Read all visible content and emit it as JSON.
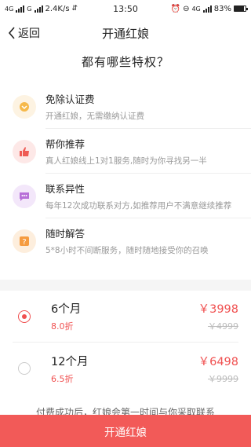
{
  "status_bar": {
    "network_1": "4G",
    "network_2": "G",
    "speed": "2.4K/s",
    "time": "13:50",
    "network_3": "4G",
    "battery": "83%",
    "battery_level": 0.83
  },
  "nav": {
    "back_label": "返回",
    "title": "开通红娘"
  },
  "heading": "都有哪些特权？",
  "features": [
    {
      "title": "免除认证费",
      "desc": "开通红娘，无需缴纳认证费",
      "icon": "badge-icon",
      "color": "#f6b94a",
      "bg": "#fdf3e2"
    },
    {
      "title": "帮你推荐",
      "desc": "真人红娘线上1对1服务,随时为你寻找另一半",
      "icon": "thumbs-up-icon",
      "color": "#ef5b54",
      "bg": "#fde8e7"
    },
    {
      "title": "联系异性",
      "desc": "每年12次成功联系对方,如推荐用户不满意继续推荐",
      "icon": "chat-icon",
      "color": "#b76fd8",
      "bg": "#f3e7fa"
    },
    {
      "title": "随时解答",
      "desc": "5*8小时不间断服务，随时随地接受你的召唤",
      "icon": "question-icon",
      "color": "#f59b3f",
      "bg": "#fdeedd"
    }
  ],
  "plans": [
    {
      "name": "6个月",
      "discount": "8.0折",
      "price": "￥3998",
      "original": "￥4999",
      "selected": true
    },
    {
      "name": "12个月",
      "discount": "6.5折",
      "price": "￥6498",
      "original": "￥9999",
      "selected": false
    }
  ],
  "note": "付费成功后，红娘会第一时间与你采取联系",
  "cta_label": "开通红娘"
}
